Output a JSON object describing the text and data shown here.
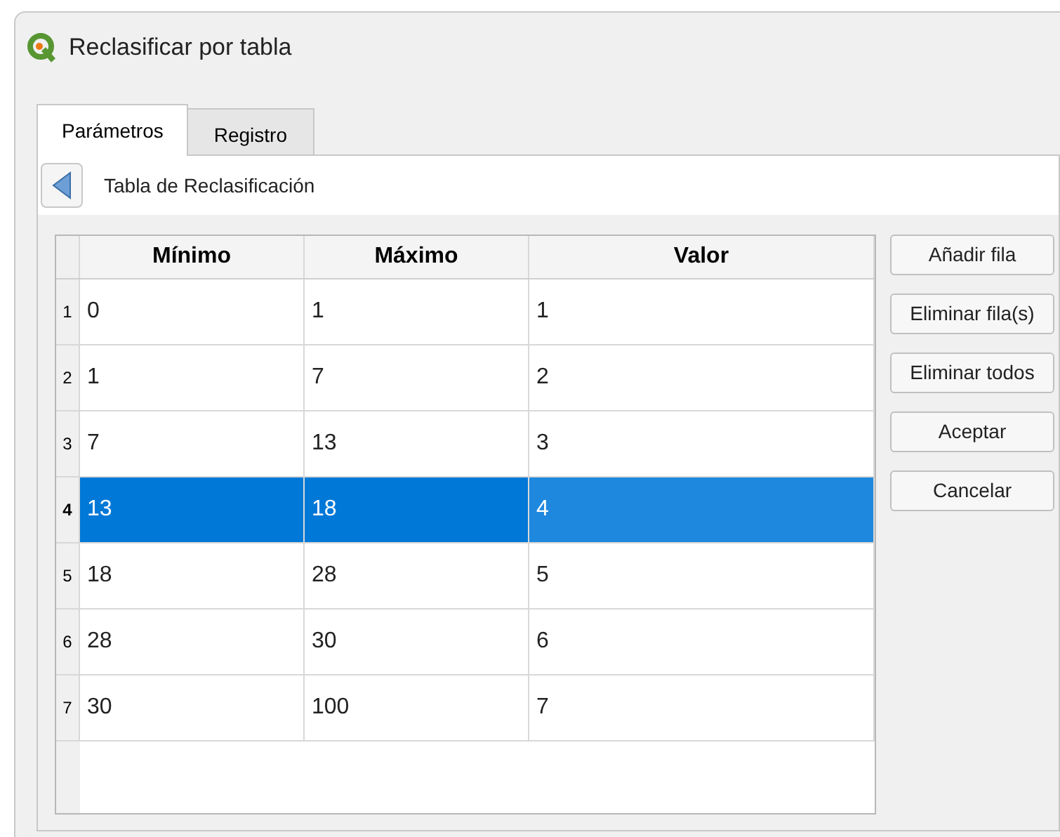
{
  "window": {
    "title": "Reclasificar por tabla"
  },
  "tabs": [
    {
      "label": "Parámetros",
      "selected": true
    },
    {
      "label": "Registro",
      "selected": false
    }
  ],
  "section": {
    "title": "Tabla de Reclasificación"
  },
  "table": {
    "columns": [
      "Mínimo",
      "Máximo",
      "Valor"
    ],
    "rows": [
      {
        "header": "1",
        "cells": [
          "0",
          "1",
          "1"
        ],
        "selected": false
      },
      {
        "header": "2",
        "cells": [
          "1",
          "7",
          "2"
        ],
        "selected": false
      },
      {
        "header": "3",
        "cells": [
          "7",
          "13",
          "3"
        ],
        "selected": false
      },
      {
        "header": "4",
        "cells": [
          "13",
          "18",
          "4"
        ],
        "selected": true
      },
      {
        "header": "5",
        "cells": [
          "18",
          "28",
          "5"
        ],
        "selected": false
      },
      {
        "header": "6",
        "cells": [
          "28",
          "30",
          "6"
        ],
        "selected": false
      },
      {
        "header": "7",
        "cells": [
          "30",
          "100",
          "7"
        ],
        "selected": false
      }
    ]
  },
  "buttons": [
    "Añadir fila",
    "Eliminar fila(s)",
    "Eliminar todos",
    "Aceptar",
    "Cancelar"
  ]
}
